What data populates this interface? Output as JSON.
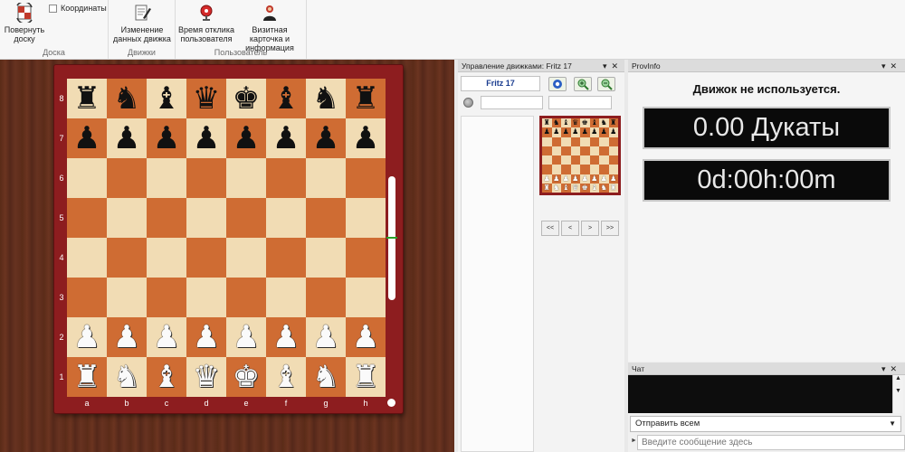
{
  "ribbon": {
    "flip_board": "Повернуть доску",
    "coordinates": "Координаты",
    "group_board": "Доска",
    "change_engine_data": "Изменение данных движка",
    "group_engines": "Движки",
    "user_response_time": "Время отклика пользователя",
    "business_card": "Визитная карточка и информация",
    "group_user": "Пользователь"
  },
  "board": {
    "ranks": [
      "8",
      "7",
      "6",
      "5",
      "4",
      "3",
      "2",
      "1"
    ],
    "files": [
      "a",
      "b",
      "c",
      "d",
      "e",
      "f",
      "g",
      "h"
    ],
    "position": [
      [
        "br",
        "bn",
        "bb",
        "bq",
        "bk",
        "bb",
        "bn",
        "br"
      ],
      [
        "bp",
        "bp",
        "bp",
        "bp",
        "bp",
        "bp",
        "bp",
        "bp"
      ],
      [
        "",
        "",
        "",
        "",
        "",
        "",
        "",
        ""
      ],
      [
        "",
        "",
        "",
        "",
        "",
        "",
        "",
        ""
      ],
      [
        "",
        "",
        "",
        "",
        "",
        "",
        "",
        ""
      ],
      [
        "",
        "",
        "",
        "",
        "",
        "",
        "",
        ""
      ],
      [
        "wp",
        "wp",
        "wp",
        "wp",
        "wp",
        "wp",
        "wp",
        "wp"
      ],
      [
        "wr",
        "wn",
        "wb",
        "wq",
        "wk",
        "wb",
        "wn",
        "wr"
      ]
    ],
    "light_color": "#f1dcb4",
    "dark_color": "#cf6c33",
    "frame_color": "#8d1d1f"
  },
  "engine_panel": {
    "header": "Управление движками: Fritz 17",
    "engine_name": "Fritz 17",
    "nav": [
      "<<",
      "<",
      ">",
      ">>"
    ]
  },
  "prov_info": {
    "header": "ProvInfo",
    "status": "Движок не используется.",
    "ducats": "0.00 Дукаты",
    "time": "0d:00h:00m"
  },
  "chat": {
    "header": "Чат",
    "recipient": "Отправить всем",
    "placeholder": "Введите сообщение здесь"
  }
}
